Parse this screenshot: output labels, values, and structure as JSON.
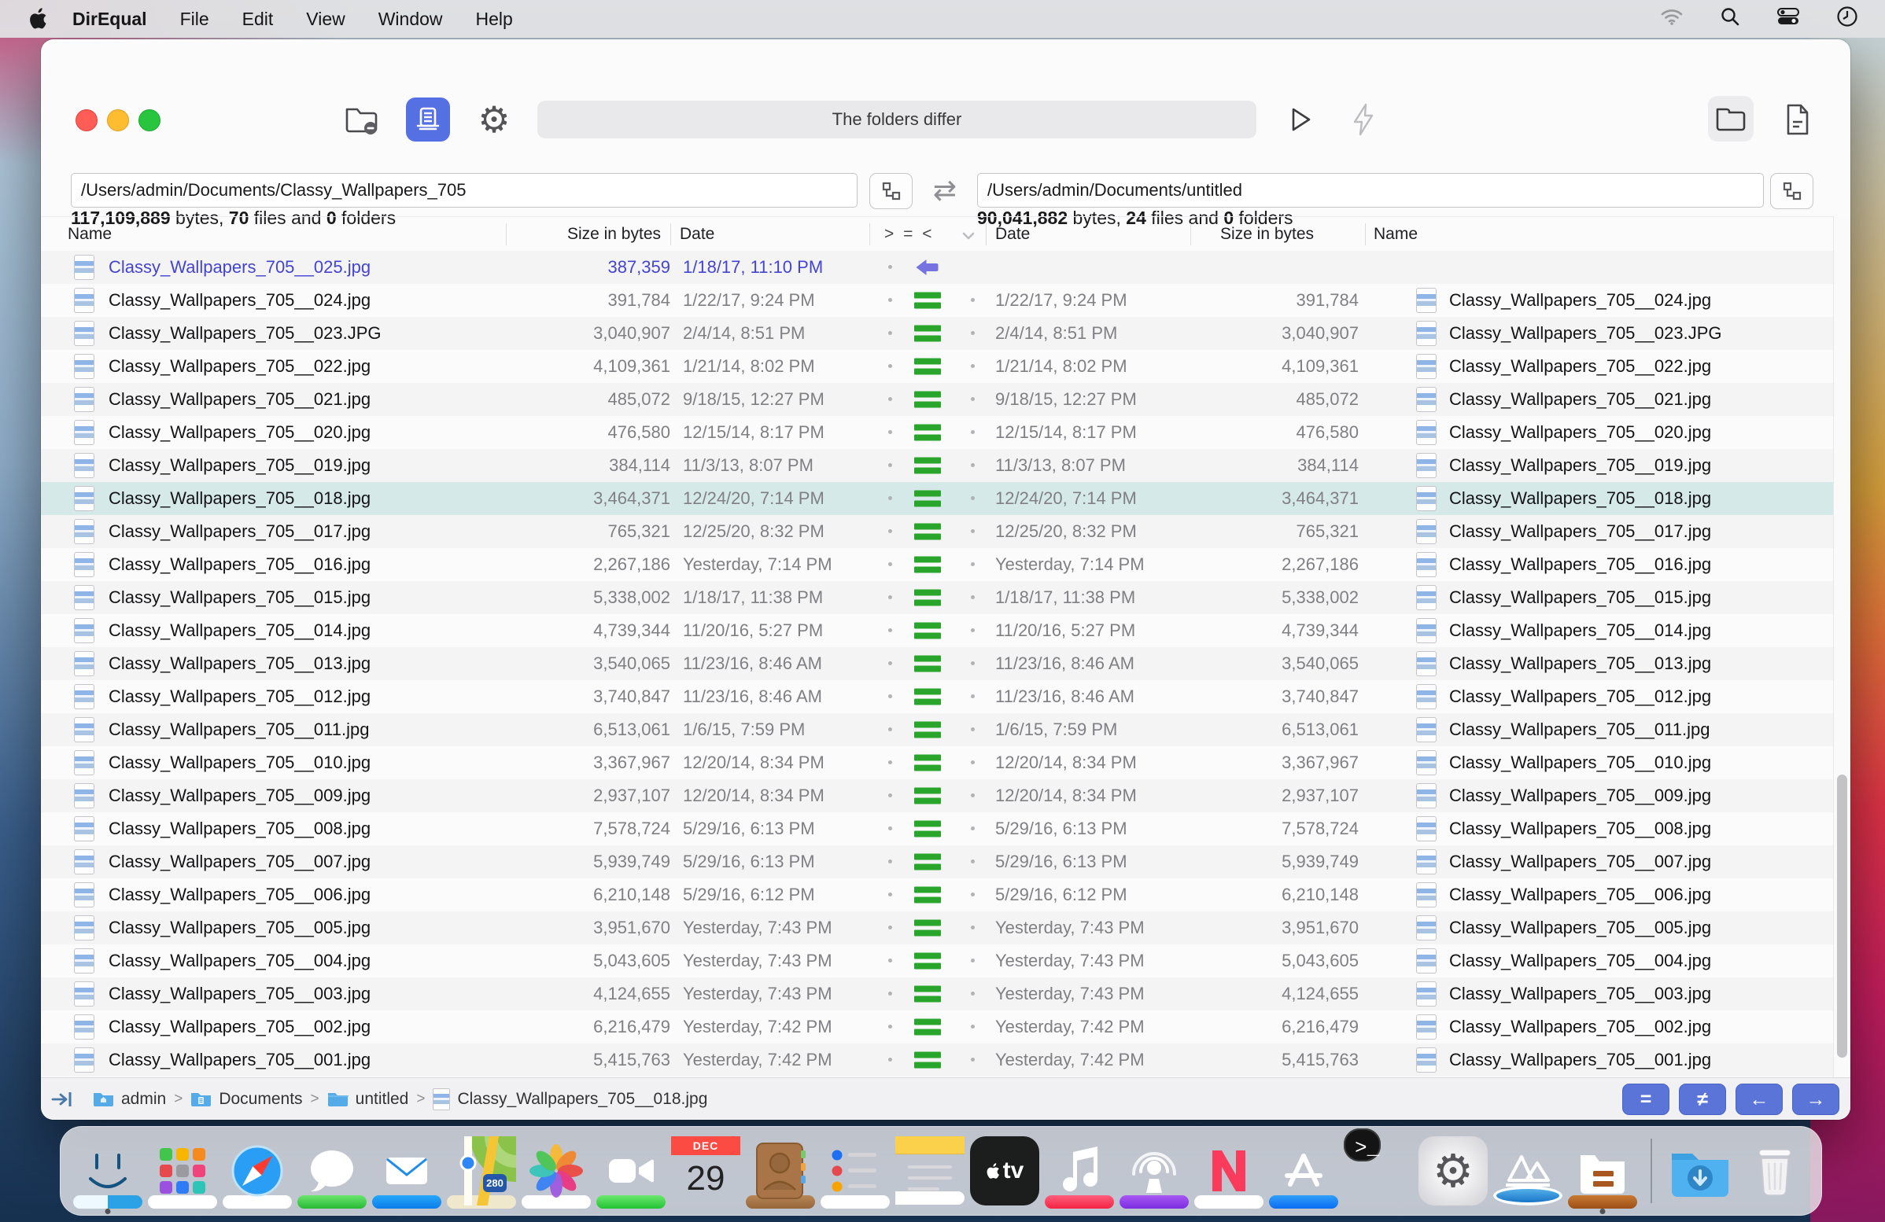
{
  "menubar": {
    "app_name": "DirEqual",
    "items": [
      {
        "label": "File"
      },
      {
        "label": "Edit"
      },
      {
        "label": "View"
      },
      {
        "label": "Window"
      },
      {
        "label": "Help"
      }
    ],
    "status_icons": [
      "wifi",
      "search",
      "control-center",
      "clock"
    ]
  },
  "window": {
    "toolbar": {
      "status_title": "The folders differ"
    },
    "paths": {
      "left": "/Users/admin/Documents/Classy_Wallpapers_705",
      "right": "/Users/admin/Documents/untitled"
    },
    "summaries": {
      "left": {
        "bytes": "117,109,889",
        "bytes_label": "bytes,",
        "files": "70",
        "files_label": "files and",
        "folders": "0",
        "folders_label": "folders"
      },
      "right": {
        "bytes": "90,041,882",
        "bytes_label": "bytes,",
        "files": "24",
        "files_label": "files and",
        "folders": "0",
        "folders_label": "folders"
      }
    },
    "table": {
      "headers": {
        "name_left": "Name",
        "size_left": "Size in bytes",
        "date_left": "Date",
        "compare": "> = <",
        "date_right": "Date",
        "size_right": "Size in bytes",
        "name_right": "Name"
      },
      "rows": [
        {
          "state": "leftonly",
          "marker": "left",
          "left": {
            "name": "Classy_Wallpapers_705__025.jpg",
            "size": "387,359",
            "date": "1/18/17, 11:10 PM"
          },
          "right": {
            "date": "",
            "size": "",
            "name": ""
          }
        },
        {
          "state": "normal",
          "marker": "equal",
          "left": {
            "name": "Classy_Wallpapers_705__024.jpg",
            "size": "391,784",
            "date": "1/22/17, 9:24 PM"
          },
          "right": {
            "date": "1/22/17, 9:24 PM",
            "size": "391,784",
            "name": "Classy_Wallpapers_705__024.jpg"
          }
        },
        {
          "state": "normal",
          "marker": "equal",
          "left": {
            "name": "Classy_Wallpapers_705__023.JPG",
            "size": "3,040,907",
            "date": "2/4/14, 8:51 PM"
          },
          "right": {
            "date": "2/4/14, 8:51 PM",
            "size": "3,040,907",
            "name": "Classy_Wallpapers_705__023.JPG"
          }
        },
        {
          "state": "normal",
          "marker": "equal",
          "left": {
            "name": "Classy_Wallpapers_705__022.jpg",
            "size": "4,109,361",
            "date": "1/21/14, 8:02 PM"
          },
          "right": {
            "date": "1/21/14, 8:02 PM",
            "size": "4,109,361",
            "name": "Classy_Wallpapers_705__022.jpg"
          }
        },
        {
          "state": "normal",
          "marker": "equal",
          "left": {
            "name": "Classy_Wallpapers_705__021.jpg",
            "size": "485,072",
            "date": "9/18/15, 12:27 PM"
          },
          "right": {
            "date": "9/18/15, 12:27 PM",
            "size": "485,072",
            "name": "Classy_Wallpapers_705__021.jpg"
          }
        },
        {
          "state": "normal",
          "marker": "equal",
          "left": {
            "name": "Classy_Wallpapers_705__020.jpg",
            "size": "476,580",
            "date": "12/15/14, 8:17 PM"
          },
          "right": {
            "date": "12/15/14, 8:17 PM",
            "size": "476,580",
            "name": "Classy_Wallpapers_705__020.jpg"
          }
        },
        {
          "state": "normal",
          "marker": "equal",
          "left": {
            "name": "Classy_Wallpapers_705__019.jpg",
            "size": "384,114",
            "date": "11/3/13, 8:07 PM"
          },
          "right": {
            "date": "11/3/13, 8:07 PM",
            "size": "384,114",
            "name": "Classy_Wallpapers_705__019.jpg"
          }
        },
        {
          "state": "selected",
          "marker": "equal",
          "left": {
            "name": "Classy_Wallpapers_705__018.jpg",
            "size": "3,464,371",
            "date": "12/24/20, 7:14 PM"
          },
          "right": {
            "date": "12/24/20, 7:14 PM",
            "size": "3,464,371",
            "name": "Classy_Wallpapers_705__018.jpg"
          }
        },
        {
          "state": "normal",
          "marker": "equal",
          "left": {
            "name": "Classy_Wallpapers_705__017.jpg",
            "size": "765,321",
            "date": "12/25/20, 8:32 PM"
          },
          "right": {
            "date": "12/25/20, 8:32 PM",
            "size": "765,321",
            "name": "Classy_Wallpapers_705__017.jpg"
          }
        },
        {
          "state": "normal",
          "marker": "equal",
          "left": {
            "name": "Classy_Wallpapers_705__016.jpg",
            "size": "2,267,186",
            "date": "Yesterday, 7:14 PM"
          },
          "right": {
            "date": "Yesterday, 7:14 PM",
            "size": "2,267,186",
            "name": "Classy_Wallpapers_705__016.jpg"
          }
        },
        {
          "state": "normal",
          "marker": "equal",
          "left": {
            "name": "Classy_Wallpapers_705__015.jpg",
            "size": "5,338,002",
            "date": "1/18/17, 11:38 PM"
          },
          "right": {
            "date": "1/18/17, 11:38 PM",
            "size": "5,338,002",
            "name": "Classy_Wallpapers_705__015.jpg"
          }
        },
        {
          "state": "normal",
          "marker": "equal",
          "left": {
            "name": "Classy_Wallpapers_705__014.jpg",
            "size": "4,739,344",
            "date": "11/20/16, 5:27 PM"
          },
          "right": {
            "date": "11/20/16, 5:27 PM",
            "size": "4,739,344",
            "name": "Classy_Wallpapers_705__014.jpg"
          }
        },
        {
          "state": "normal",
          "marker": "equal",
          "left": {
            "name": "Classy_Wallpapers_705__013.jpg",
            "size": "3,540,065",
            "date": "11/23/16, 8:46 AM"
          },
          "right": {
            "date": "11/23/16, 8:46 AM",
            "size": "3,540,065",
            "name": "Classy_Wallpapers_705__013.jpg"
          }
        },
        {
          "state": "normal",
          "marker": "equal",
          "left": {
            "name": "Classy_Wallpapers_705__012.jpg",
            "size": "3,740,847",
            "date": "11/23/16, 8:46 AM"
          },
          "right": {
            "date": "11/23/16, 8:46 AM",
            "size": "3,740,847",
            "name": "Classy_Wallpapers_705__012.jpg"
          }
        },
        {
          "state": "normal",
          "marker": "equal",
          "left": {
            "name": "Classy_Wallpapers_705__011.jpg",
            "size": "6,513,061",
            "date": "1/6/15, 7:59 PM"
          },
          "right": {
            "date": "1/6/15, 7:59 PM",
            "size": "6,513,061",
            "name": "Classy_Wallpapers_705__011.jpg"
          }
        },
        {
          "state": "normal",
          "marker": "equal",
          "left": {
            "name": "Classy_Wallpapers_705__010.jpg",
            "size": "3,367,967",
            "date": "12/20/14, 8:34 PM"
          },
          "right": {
            "date": "12/20/14, 8:34 PM",
            "size": "3,367,967",
            "name": "Classy_Wallpapers_705__010.jpg"
          }
        },
        {
          "state": "normal",
          "marker": "equal",
          "left": {
            "name": "Classy_Wallpapers_705__009.jpg",
            "size": "2,937,107",
            "date": "12/20/14, 8:34 PM"
          },
          "right": {
            "date": "12/20/14, 8:34 PM",
            "size": "2,937,107",
            "name": "Classy_Wallpapers_705__009.jpg"
          }
        },
        {
          "state": "normal",
          "marker": "equal",
          "left": {
            "name": "Classy_Wallpapers_705__008.jpg",
            "size": "7,578,724",
            "date": "5/29/16, 6:13 PM"
          },
          "right": {
            "date": "5/29/16, 6:13 PM",
            "size": "7,578,724",
            "name": "Classy_Wallpapers_705__008.jpg"
          }
        },
        {
          "state": "normal",
          "marker": "equal",
          "left": {
            "name": "Classy_Wallpapers_705__007.jpg",
            "size": "5,939,749",
            "date": "5/29/16, 6:13 PM"
          },
          "right": {
            "date": "5/29/16, 6:13 PM",
            "size": "5,939,749",
            "name": "Classy_Wallpapers_705__007.jpg"
          }
        },
        {
          "state": "normal",
          "marker": "equal",
          "left": {
            "name": "Classy_Wallpapers_705__006.jpg",
            "size": "6,210,148",
            "date": "5/29/16, 6:12 PM"
          },
          "right": {
            "date": "5/29/16, 6:12 PM",
            "size": "6,210,148",
            "name": "Classy_Wallpapers_705__006.jpg"
          }
        },
        {
          "state": "normal",
          "marker": "equal",
          "left": {
            "name": "Classy_Wallpapers_705__005.jpg",
            "size": "3,951,670",
            "date": "Yesterday, 7:43 PM"
          },
          "right": {
            "date": "Yesterday, 7:43 PM",
            "size": "3,951,670",
            "name": "Classy_Wallpapers_705__005.jpg"
          }
        },
        {
          "state": "normal",
          "marker": "equal",
          "left": {
            "name": "Classy_Wallpapers_705__004.jpg",
            "size": "5,043,605",
            "date": "Yesterday, 7:43 PM"
          },
          "right": {
            "date": "Yesterday, 7:43 PM",
            "size": "5,043,605",
            "name": "Classy_Wallpapers_705__004.jpg"
          }
        },
        {
          "state": "normal",
          "marker": "equal",
          "left": {
            "name": "Classy_Wallpapers_705__003.jpg",
            "size": "4,124,655",
            "date": "Yesterday, 7:43 PM"
          },
          "right": {
            "date": "Yesterday, 7:43 PM",
            "size": "4,124,655",
            "name": "Classy_Wallpapers_705__003.jpg"
          }
        },
        {
          "state": "normal",
          "marker": "equal",
          "left": {
            "name": "Classy_Wallpapers_705__002.jpg",
            "size": "6,216,479",
            "date": "Yesterday, 7:42 PM"
          },
          "right": {
            "date": "Yesterday, 7:42 PM",
            "size": "6,216,479",
            "name": "Classy_Wallpapers_705__002.jpg"
          }
        },
        {
          "state": "normal",
          "marker": "equal",
          "left": {
            "name": "Classy_Wallpapers_705__001.jpg",
            "size": "5,415,763",
            "date": "Yesterday, 7:42 PM"
          },
          "right": {
            "date": "Yesterday, 7:42 PM",
            "size": "5,415,763",
            "name": "Classy_Wallpapers_705__001.jpg"
          }
        }
      ]
    },
    "statusbar": {
      "breadcrumb": [
        {
          "label": "admin"
        },
        {
          "label": "Documents"
        },
        {
          "label": "untitled"
        },
        {
          "label": "Classy_Wallpapers_705__018.jpg"
        }
      ],
      "separator": ">",
      "buttons": [
        {
          "name": "filter-equal",
          "glyph": "="
        },
        {
          "name": "filter-not-equal",
          "glyph": "≠"
        },
        {
          "name": "filter-left-only",
          "glyph": "←"
        },
        {
          "name": "filter-right-only",
          "glyph": "→"
        }
      ]
    }
  },
  "dock": {
    "calendar": {
      "month": "DEC",
      "day": "29"
    },
    "apple_tv_label": "tv",
    "terminal_glyph": ">_",
    "gear_glyph": "⚙",
    "maps_shield": "280",
    "items": [
      "finder",
      "launchpad",
      "safari",
      "messages",
      "mail",
      "maps",
      "photos",
      "facetime",
      "calendar",
      "contacts",
      "reminders",
      "notes",
      "apple-tv",
      "music",
      "podcasts",
      "news",
      "app-store",
      "terminal",
      "system-preferences",
      "mountain-app",
      "direqual",
      "downloads",
      "trash"
    ]
  },
  "colors": {
    "accent_toolbar_blue": "#5570e2",
    "equal_green": "#2aa52c",
    "diff_indigo": "#4444d2",
    "selected_row": "#d6e9e9",
    "status_button_blue": "#5b74d8"
  }
}
